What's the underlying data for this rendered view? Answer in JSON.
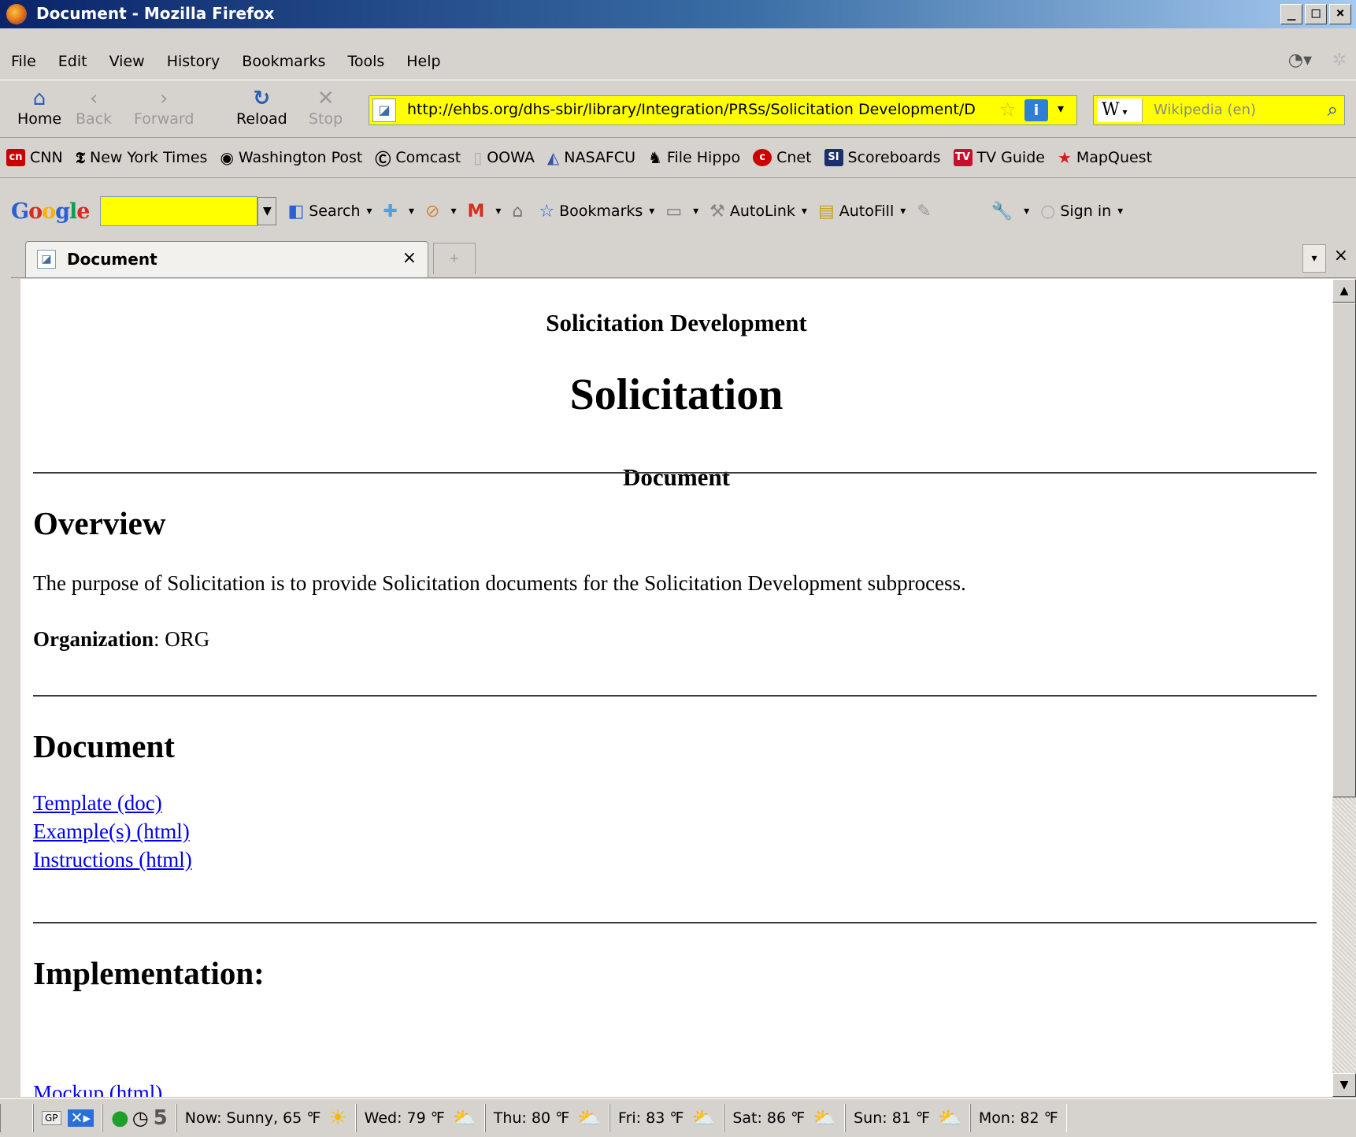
{
  "window": {
    "title": "Document - Mozilla Firefox",
    "controls": [
      "_",
      "□",
      "×"
    ]
  },
  "menu": [
    "File",
    "Edit",
    "View",
    "History",
    "Bookmarks",
    "Tools",
    "Help"
  ],
  "nav": {
    "home": "Home",
    "back": "Back",
    "forward": "Forward",
    "reload": "Reload",
    "stop": "Stop",
    "url": "http://ehbs.org/dhs-sbir/library/Integration/PRSs/Solicitation Development/D",
    "search_placeholder": "Wikipedia (en)",
    "search_engine": "W"
  },
  "bookmarks": [
    {
      "label": "CNN",
      "icon": "cnn-icon"
    },
    {
      "label": "New York Times",
      "icon": "nyt-icon"
    },
    {
      "label": "Washington Post",
      "icon": "wapo-icon"
    },
    {
      "label": "Comcast",
      "icon": "comcast-icon"
    },
    {
      "label": "OOWA",
      "icon": "page-icon"
    },
    {
      "label": "NASAFCU",
      "icon": "nasafcu-icon"
    },
    {
      "label": "File Hippo",
      "icon": "filehippo-icon"
    },
    {
      "label": "Cnet",
      "icon": "cnet-icon"
    },
    {
      "label": "Scoreboards",
      "icon": "si-icon"
    },
    {
      "label": "TV Guide",
      "icon": "tvguide-icon"
    },
    {
      "label": "MapQuest",
      "icon": "mapquest-icon"
    }
  ],
  "google_toolbar": {
    "logo": "Google",
    "search": "Search",
    "bookmarks": "Bookmarks",
    "autolink": "AutoLink",
    "autofill": "AutoFill",
    "signin": "Sign in"
  },
  "tab": {
    "label": "Document"
  },
  "page": {
    "subtitle": "Solicitation Development",
    "title": "Solicitation",
    "doc_type": "Document",
    "overview_heading": "Overview",
    "overview_text": "The purpose of Solicitation is to provide Solicitation documents for the Solicitation Development subprocess.",
    "org_label": "Organization",
    "org_value": ": ORG",
    "document_heading": "Document",
    "links": [
      "Template (doc)",
      "Example(s) (html)",
      "Instructions (html)"
    ],
    "implementation_heading": "Implementation:",
    "impl_link": "Mockup (html)"
  },
  "status": {
    "gp": "GP",
    "counter": "5",
    "weather": [
      "Now: Sunny, 65 ℉",
      "Wed: 79 ℉",
      "Thu: 80 ℉",
      "Fri: 83 ℉",
      "Sat: 86 ℉",
      "Sun: 81 ℉",
      "Mon: 82 ℉"
    ]
  }
}
